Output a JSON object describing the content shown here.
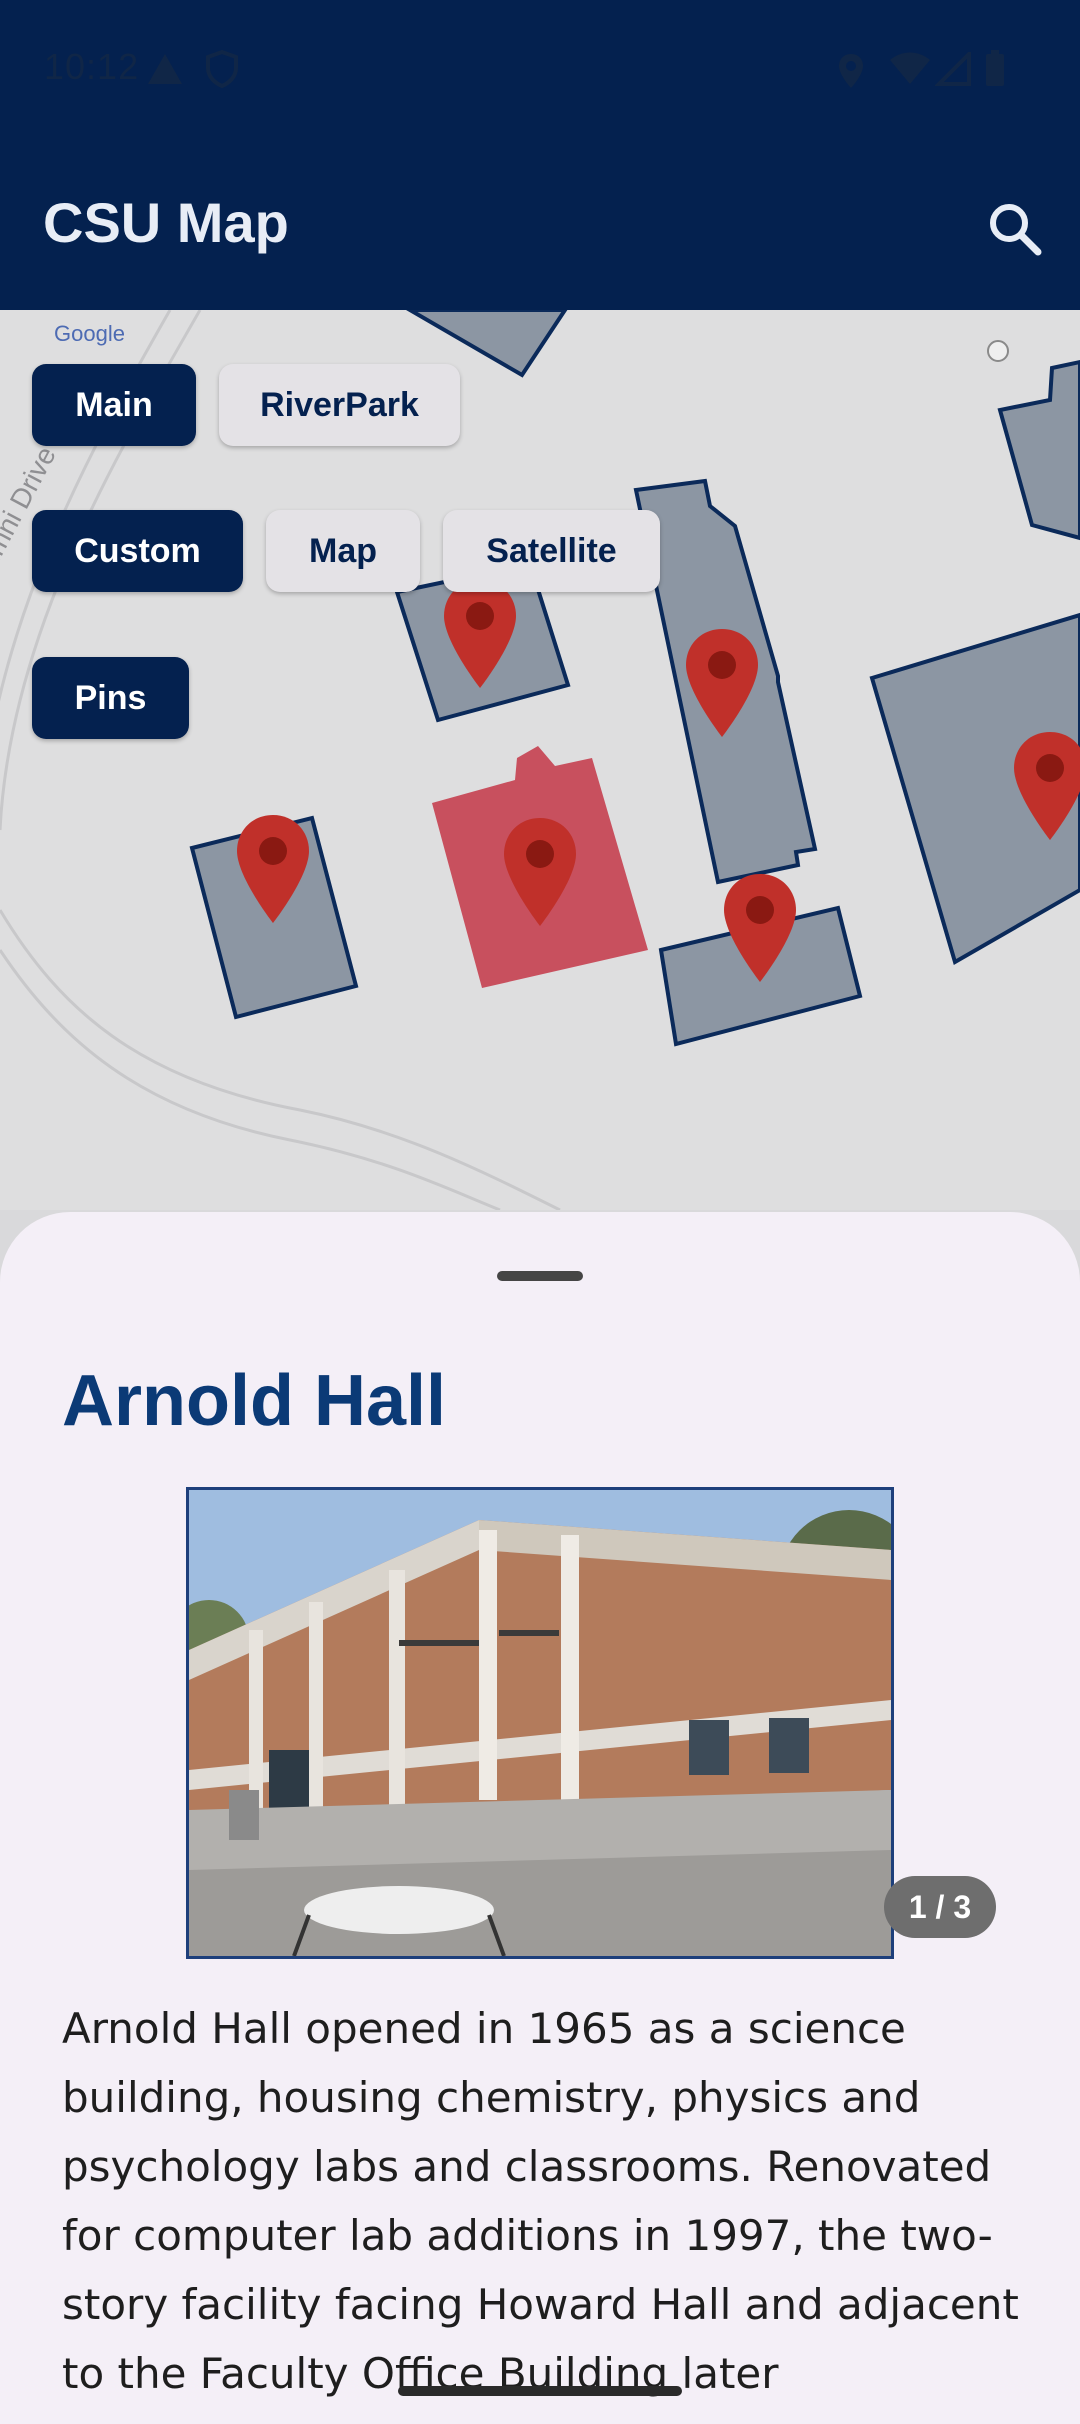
{
  "status_bar": {
    "time": "10:12"
  },
  "app_bar": {
    "title": "CSU Map",
    "search_icon": "search-icon"
  },
  "map": {
    "attribution": "Google",
    "road_label": "Alumni Drive",
    "campus_chips": [
      {
        "label": "Main",
        "selected": true
      },
      {
        "label": "RiverPark",
        "selected": false
      }
    ],
    "map_type_chips": [
      {
        "label": "Custom",
        "selected": true
      },
      {
        "label": "Map",
        "selected": false
      },
      {
        "label": "Satellite",
        "selected": false
      }
    ],
    "layer_chips": [
      {
        "label": "Pins",
        "selected": true
      }
    ],
    "colors": {
      "building_fill": "#8c96a3",
      "building_stroke": "#0b2a5a",
      "selected_building": "#c8505e",
      "pin": "#c0302a"
    }
  },
  "sheet": {
    "title": "Arnold Hall",
    "image_counter": "1 / 3",
    "description": "Arnold Hall opened in 1965 as a science building, housing chemistry, physics and psychology labs and classrooms. Renovated for computer lab additions in 1997, the two-story facility facing Howard Hall and adjacent to the Faculty Office Building later"
  },
  "colors": {
    "primary": "#04214f",
    "title": "#0b3a76",
    "sheet_bg": "#f4eff7"
  }
}
